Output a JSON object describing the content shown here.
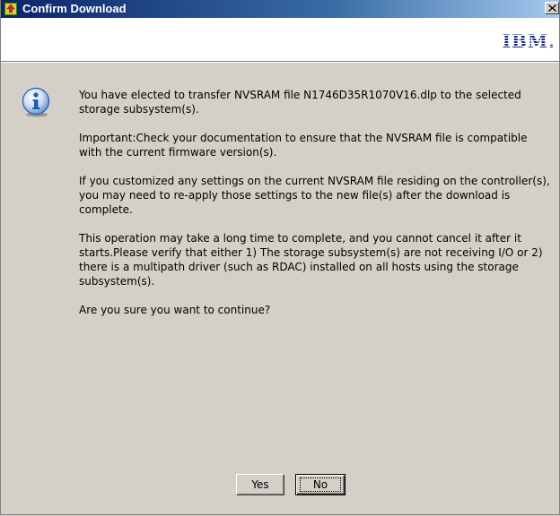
{
  "window": {
    "title": "Confirm Download",
    "brand": "IBM."
  },
  "message": {
    "paragraphs": [
      "You have elected to transfer NVSRAM file N1746D35R1070V16.dlp to the selected storage subsystem(s).",
      "Important:Check your documentation to ensure that the NVSRAM file is compatible with the current firmware version(s).",
      "If you customized any settings on the current NVSRAM file residing on the controller(s), you may need to re-apply those settings to the new file(s) after the download is complete.",
      "This operation may take a long time to complete, and you cannot cancel it after it starts.Please verify that either 1) The storage subsystem(s) are not receiving I/O or 2) there is a multipath driver (such as RDAC) installed on all hosts using the storage subsystem(s).",
      "Are you sure you want to continue?"
    ]
  },
  "buttons": {
    "yes_label": "Yes",
    "no_label": "No"
  },
  "icons": {
    "title_icon": "download-app-icon",
    "close_icon": "close-icon",
    "message_icon": "info-icon"
  },
  "colors": {
    "titlebar_start": "#0a246a",
    "titlebar_end": "#a6caf0",
    "dialog_bg": "#d4d0c8",
    "brand_bar_bg": "#ffffff",
    "ibm_blue": "#1b2a78",
    "info_icon_blue": "#1e5bb8"
  }
}
